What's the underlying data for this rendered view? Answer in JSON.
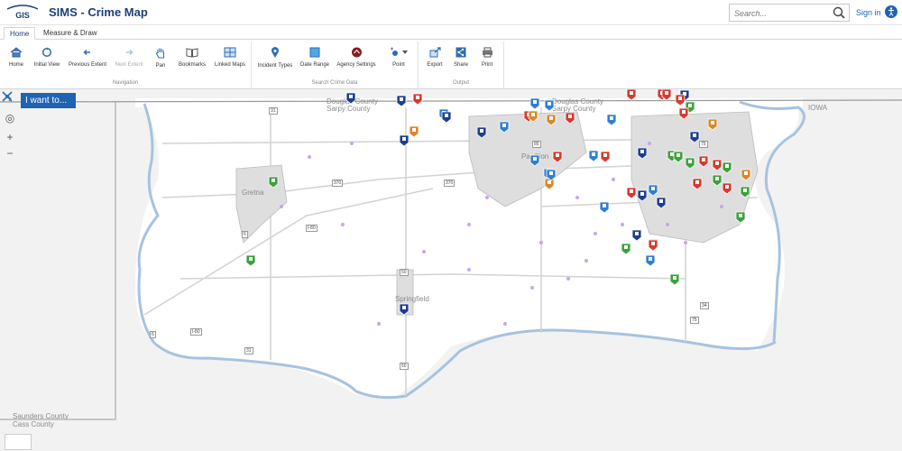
{
  "header": {
    "title": "SIMS - Crime Map",
    "search_placeholder": "Search...",
    "signin_label": "Sign in"
  },
  "tabs": [
    {
      "label": "Home",
      "active": true
    },
    {
      "label": "Measure & Draw",
      "active": false
    }
  ],
  "ribbon": {
    "navigation": {
      "label": "Navigation",
      "tools": [
        "Home",
        "Initial View",
        "Previous Extent",
        "Next Extent",
        "Pan",
        "Bookmarks",
        "Linked Maps"
      ]
    },
    "search": {
      "label": "Search Crime Data",
      "tools": [
        "Incident Types",
        "Date Range",
        "Agency Settings",
        "Point"
      ]
    },
    "output": {
      "label": "Output",
      "tools": [
        "Export",
        "Share",
        "Print"
      ]
    }
  },
  "map": {
    "iwant_label": "I want to...",
    "labels": {
      "douglas1": "Douglas County",
      "sarpy1": "Sarpy County",
      "douglas2": "Douglas County",
      "sarpy2": "Sarpy County",
      "gretna": "Gretna",
      "papillion": "Papillion",
      "springfield": "Springfield",
      "saunders": "Saunders County",
      "cass": "Cass County",
      "iowa": "IOWA"
    },
    "roads": {
      "r31a": "31",
      "r370a": "370",
      "r370b": "370",
      "r80a": "I-80",
      "r6a": "6",
      "r80b": "I-80",
      "r50a": "50",
      "r50b": "50",
      "r31b": "31",
      "r85": "85",
      "r75a": "75",
      "r75b": "75",
      "r34": "34",
      "r6b": "6"
    }
  }
}
